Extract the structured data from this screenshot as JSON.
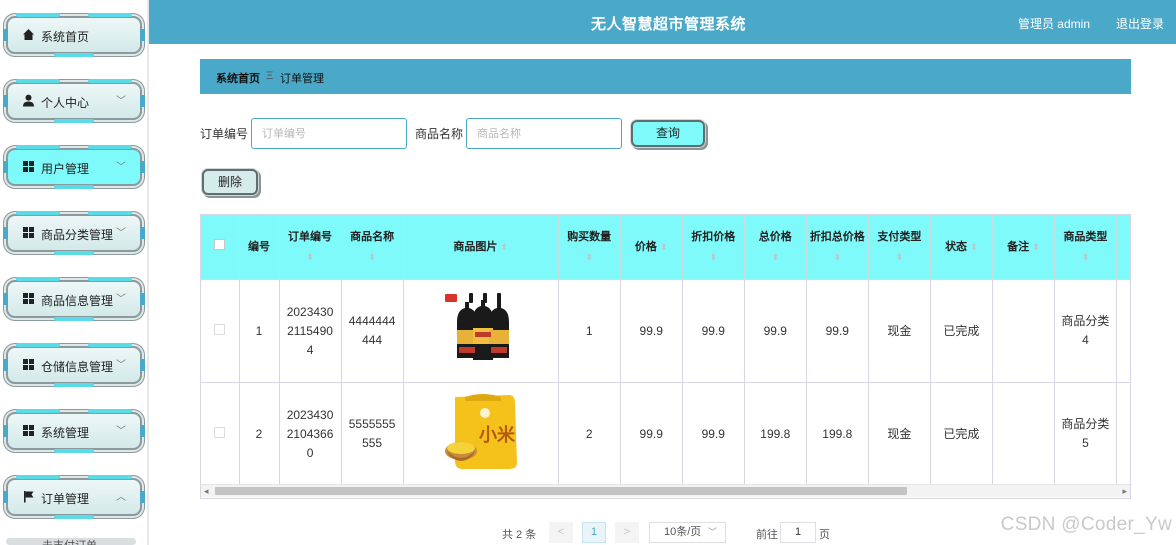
{
  "header": {
    "title": "无人智慧超市管理系统",
    "admin": "管理员 admin",
    "logout": "退出登录"
  },
  "sidebar": {
    "items": [
      {
        "label": "系统首页",
        "icon": "home-icon",
        "expandable": false
      },
      {
        "label": "个人中心",
        "icon": "user-icon",
        "expandable": true
      },
      {
        "label": "用户管理",
        "icon": "grid-icon",
        "expandable": true
      },
      {
        "label": "商品分类管理",
        "icon": "grid-icon",
        "expandable": true
      },
      {
        "label": "商品信息管理",
        "icon": "grid-icon",
        "expandable": true
      },
      {
        "label": "仓储信息管理",
        "icon": "grid-icon",
        "expandable": true
      },
      {
        "label": "系统管理",
        "icon": "grid-icon",
        "expandable": true
      },
      {
        "label": "订单管理",
        "icon": "flag-icon",
        "expandable": true,
        "expanded": true
      }
    ],
    "partial_item": "未支付订单"
  },
  "breadcrumb": {
    "home": "系统首页",
    "separator": "Ξ",
    "current": "订单管理"
  },
  "search": {
    "order_label": "订单编号",
    "order_placeholder": "订单编号",
    "product_label": "商品名称",
    "product_placeholder": "商品名称",
    "query_button": "查询"
  },
  "actions": {
    "delete_button": "删除"
  },
  "table": {
    "headers": [
      "编号",
      "订单编号",
      "商品名称",
      "商品图片",
      "购买数量",
      "价格",
      "折扣价格",
      "总价格",
      "折扣总价格",
      "支付类型",
      "状态",
      "备注",
      "商品类型"
    ],
    "rows": [
      {
        "index": "1",
        "order_no": "20234302115490 4",
        "product_name": "4444444444",
        "image": "soy-sauce-bottles",
        "quantity": "1",
        "price": "99.9",
        "discount_price": "99.9",
        "total": "99.9",
        "discount_total": "99.9",
        "pay_type": "现金",
        "status": "已完成",
        "note": "",
        "category": "商品分类4"
      },
      {
        "index": "2",
        "order_no": "20234302104366 0",
        "product_name": "5555555555",
        "image": "millet-bag",
        "quantity": "2",
        "price": "99.9",
        "discount_price": "99.9",
        "total": "199.8",
        "discount_total": "199.8",
        "pay_type": "现金",
        "status": "已完成",
        "note": "",
        "category": "商品分类5"
      }
    ]
  },
  "pagination": {
    "total": "共 2 条",
    "prev": "<",
    "current": "1",
    "next": ">",
    "page_size": "10条/页",
    "goto_label": "前往",
    "goto_value": "1",
    "page_suffix": "页"
  },
  "watermark": "CSDN @Coder_Yw",
  "colors": {
    "header": "#4aa8c8",
    "accent": "#7ffafa"
  }
}
